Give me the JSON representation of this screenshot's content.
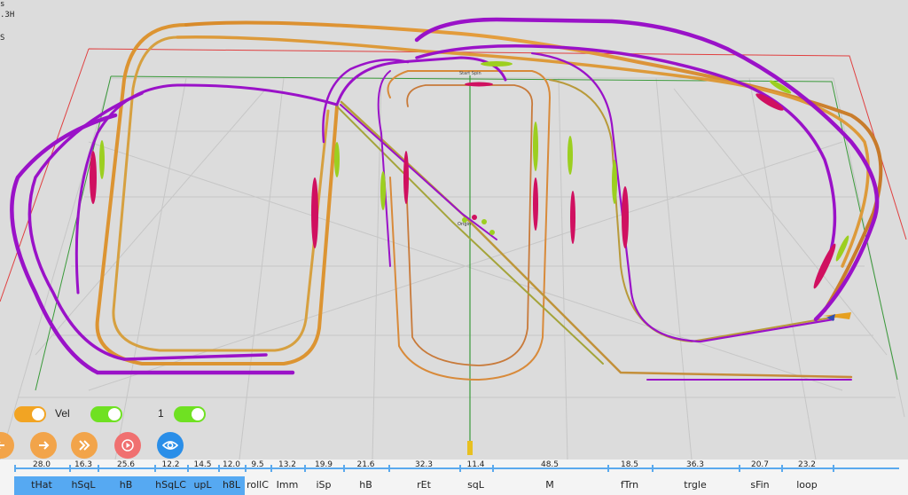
{
  "hud": {
    "line1": "s",
    "line2": ".3H",
    "line3": "S"
  },
  "scene": {
    "center_label": "Origin",
    "top_label": "Start Spin",
    "colors": {
      "purple": "#9a12c8",
      "orange": "#dc9432",
      "olive": "#a8a83a",
      "red_box": "#e04040",
      "green_box": "#3a9a3a",
      "grid": "#c4c4c4"
    }
  },
  "toggles": [
    {
      "label": "",
      "state": "on",
      "color": "#f2a423"
    },
    {
      "label": "Vel",
      "state": "on",
      "color": "#6fe122"
    },
    {
      "label": "1",
      "state": "on",
      "color": "#6fe122"
    }
  ],
  "buttons": [
    {
      "name": "back-button",
      "icon": "arrow-left-icon",
      "color": "#f2a44a"
    },
    {
      "name": "forward-button",
      "icon": "arrow-right-icon",
      "color": "#f2a44a"
    },
    {
      "name": "fast-forward-button",
      "icon": "double-chevron-right-icon",
      "color": "#f2a44a"
    },
    {
      "name": "play-button",
      "icon": "play-icon",
      "color": "#f07070"
    },
    {
      "name": "view-button",
      "icon": "eye-icon",
      "color": "#2a8ee8"
    }
  ],
  "timeline": {
    "segments": [
      {
        "label": "tHat",
        "value": "28.0",
        "selected": true
      },
      {
        "label": "hSqL",
        "value": "16.3",
        "selected": true
      },
      {
        "label": "hB",
        "value": "25.6",
        "selected": true
      },
      {
        "label": "hSqLC",
        "value": "12.2",
        "selected": true
      },
      {
        "label": "upL",
        "value": "14.5",
        "selected": true
      },
      {
        "label": "h8L",
        "value": "12.0",
        "selected": true
      },
      {
        "label": "rollC",
        "value": "9.5",
        "selected": false
      },
      {
        "label": "Imm",
        "value": "13.2",
        "selected": false
      },
      {
        "label": "iSp",
        "value": "19.9",
        "selected": false
      },
      {
        "label": "hB",
        "value": "21.6",
        "selected": false
      },
      {
        "label": "rEt",
        "value": "32.3",
        "selected": false
      },
      {
        "label": "sqL",
        "value": "11.4",
        "selected": false
      },
      {
        "label": "M",
        "value": "48.5",
        "selected": false
      },
      {
        "label": "fTrn",
        "value": "18.5",
        "selected": false
      },
      {
        "label": "trgle",
        "value": "36.3",
        "selected": false
      },
      {
        "label": "sFin",
        "value": "20.7",
        "selected": false
      },
      {
        "label": "loop",
        "value": "23.2",
        "selected": false
      }
    ]
  }
}
